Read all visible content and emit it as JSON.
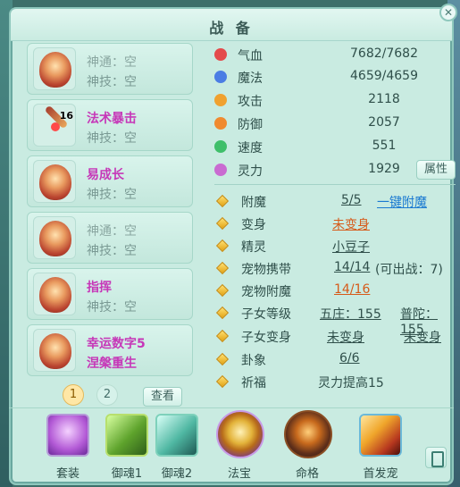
{
  "window": {
    "title": "战 备",
    "close_glyph": "✕"
  },
  "pets": [
    {
      "line1": "神通：空",
      "line2": "神技：空",
      "line1_style": "muted",
      "icon": "flame-medal-icon"
    },
    {
      "line1": "法术暴击",
      "line2": "神技：空",
      "line1_style": "purple",
      "icon": "staff-weapon-icon",
      "level": "16"
    },
    {
      "line1": "易成长",
      "line2": "神技：空",
      "line1_style": "purple",
      "icon": "flame-medal-icon"
    },
    {
      "line1": "神通：空",
      "line2": "神技：空",
      "line1_style": "muted",
      "icon": "dragon-ring-icon"
    },
    {
      "line1": "指挥",
      "line2": "神技：空",
      "line1_style": "purple",
      "icon": "flame-medal-icon"
    },
    {
      "line1": "幸运数字5",
      "line2": "涅槃重生",
      "line1_style": "purple",
      "line2_style": "purple",
      "icon": "flame-armor-icon"
    }
  ],
  "pager": {
    "page1": "1",
    "page2": "2",
    "view_label": "查看"
  },
  "stats": [
    {
      "label": "气血",
      "value": "7682/7682",
      "icon": "heart-icon",
      "color": "#e44b4b"
    },
    {
      "label": "魔法",
      "value": "4659/4659",
      "icon": "mana-icon",
      "color": "#4b7de4"
    },
    {
      "label": "攻击",
      "value": "2118",
      "icon": "attack-icon",
      "color": "#f0a12f"
    },
    {
      "label": "防御",
      "value": "2057",
      "icon": "defense-icon",
      "color": "#f08a2f"
    },
    {
      "label": "速度",
      "value": "551",
      "icon": "speed-icon",
      "color": "#3fbf6a"
    },
    {
      "label": "灵力",
      "value": "1929",
      "icon": "spirit-icon",
      "color": "#c96bd1"
    }
  ],
  "attributes_button": "属性",
  "extras": {
    "fumo": {
      "label": "附魔",
      "value": "5/5",
      "action": "一键附魔"
    },
    "bianshen": {
      "label": "变身",
      "value": "未变身"
    },
    "jingling": {
      "label": "精灵",
      "value": "小豆子"
    },
    "chongwu_xiedai": {
      "label": "宠物携带",
      "value": "14/14",
      "note": "(可出战：7)"
    },
    "chongwu_fumo": {
      "label": "宠物附魔",
      "value": "14/16"
    },
    "zinv_dengji": {
      "label": "子女等级",
      "value1": "五庄：155",
      "value2": "普陀：155"
    },
    "zinv_bianshen": {
      "label": "子女变身",
      "value1": "未变身",
      "value2": "未变身"
    },
    "guaxiang": {
      "label": "卦象",
      "value": "6/6"
    },
    "qifu": {
      "label": "祈福",
      "value": "灵力提高15"
    }
  },
  "toolbar": [
    {
      "label": "套装",
      "icon": "heart-gem-icon"
    },
    {
      "label": "御魂1",
      "icon": "scroll-icon"
    },
    {
      "label": "御魂2",
      "icon": "ghost-scroll-icon"
    },
    {
      "label": "法宝",
      "icon": "treasure-bag-icon"
    },
    {
      "label": "命格",
      "icon": "fate-icon"
    },
    {
      "label": "首发宠",
      "icon": "first-pet-icon"
    }
  ]
}
